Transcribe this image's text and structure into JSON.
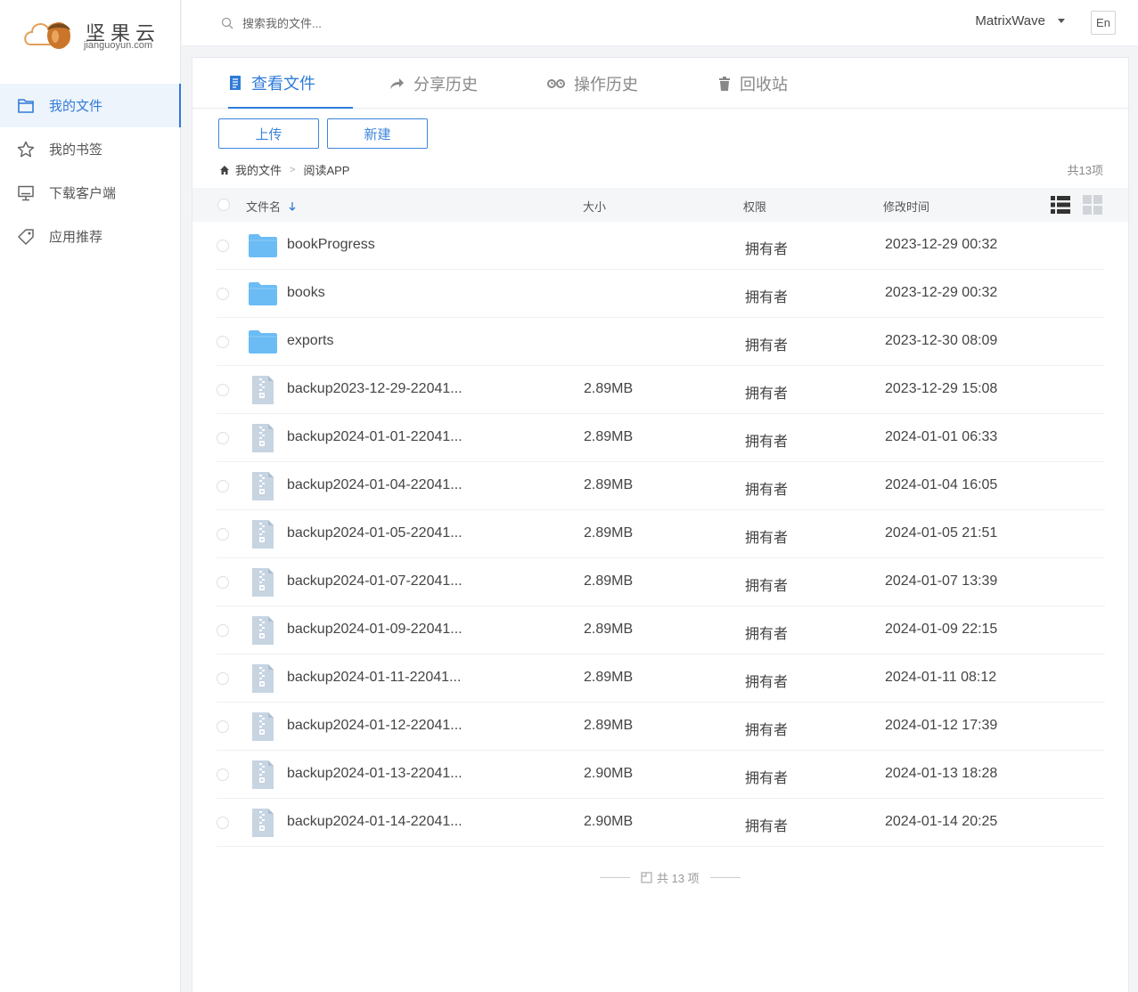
{
  "brand": {
    "name": "坚果云",
    "domain": "jianguoyun.com"
  },
  "sidebar": {
    "items": [
      {
        "label": "我的文件",
        "icon": "folder-icon",
        "active": true
      },
      {
        "label": "我的书签",
        "icon": "star-icon",
        "active": false
      },
      {
        "label": "下载客户端",
        "icon": "monitor-icon",
        "active": false
      },
      {
        "label": "应用推荐",
        "icon": "tag-icon",
        "active": false
      }
    ]
  },
  "header": {
    "search_placeholder": "搜索我的文件...",
    "user": "MatrixWave",
    "lang": "En"
  },
  "tabs": [
    {
      "label": "查看文件",
      "icon": "document-icon",
      "active": true
    },
    {
      "label": "分享历史",
      "icon": "share-arrow-icon",
      "active": false
    },
    {
      "label": "操作历史",
      "icon": "history-icon",
      "active": false
    },
    {
      "label": "回收站",
      "icon": "trash-icon",
      "active": false
    }
  ],
  "toolbar": {
    "upload_label": "上传",
    "new_label": "新建"
  },
  "breadcrumb": {
    "root": "我的文件",
    "sep": ">",
    "current": "阅读APP"
  },
  "item_count": "共13项",
  "table": {
    "headers": {
      "name": "文件名",
      "size": "大小",
      "permission": "权限",
      "modified": "修改时间"
    },
    "rows": [
      {
        "type": "folder",
        "name": "bookProgress",
        "size": "",
        "permission": "拥有者",
        "modified": "2023-12-29 00:32"
      },
      {
        "type": "folder",
        "name": "books",
        "size": "",
        "permission": "拥有者",
        "modified": "2023-12-29 00:32"
      },
      {
        "type": "folder",
        "name": "exports",
        "size": "",
        "permission": "拥有者",
        "modified": "2023-12-30 08:09"
      },
      {
        "type": "zip",
        "name": "backup2023-12-29-22041...",
        "size": "2.89MB",
        "permission": "拥有者",
        "modified": "2023-12-29 15:08"
      },
      {
        "type": "zip",
        "name": "backup2024-01-01-22041...",
        "size": "2.89MB",
        "permission": "拥有者",
        "modified": "2024-01-01 06:33"
      },
      {
        "type": "zip",
        "name": "backup2024-01-04-22041...",
        "size": "2.89MB",
        "permission": "拥有者",
        "modified": "2024-01-04 16:05"
      },
      {
        "type": "zip",
        "name": "backup2024-01-05-22041...",
        "size": "2.89MB",
        "permission": "拥有者",
        "modified": "2024-01-05 21:51"
      },
      {
        "type": "zip",
        "name": "backup2024-01-07-22041...",
        "size": "2.89MB",
        "permission": "拥有者",
        "modified": "2024-01-07 13:39"
      },
      {
        "type": "zip",
        "name": "backup2024-01-09-22041...",
        "size": "2.89MB",
        "permission": "拥有者",
        "modified": "2024-01-09 22:15"
      },
      {
        "type": "zip",
        "name": "backup2024-01-11-22041...",
        "size": "2.89MB",
        "permission": "拥有者",
        "modified": "2024-01-11 08:12"
      },
      {
        "type": "zip",
        "name": "backup2024-01-12-22041...",
        "size": "2.89MB",
        "permission": "拥有者",
        "modified": "2024-01-12 17:39"
      },
      {
        "type": "zip",
        "name": "backup2024-01-13-22041...",
        "size": "2.90MB",
        "permission": "拥有者",
        "modified": "2024-01-13 18:28"
      },
      {
        "type": "zip",
        "name": "backup2024-01-14-22041...",
        "size": "2.90MB",
        "permission": "拥有者",
        "modified": "2024-01-14 20:25"
      }
    ]
  },
  "footer_count": "共 13 项",
  "colors": {
    "accent": "#2f7bd9",
    "folder": "#6bbcf5",
    "zip": "#c7d4e2"
  }
}
